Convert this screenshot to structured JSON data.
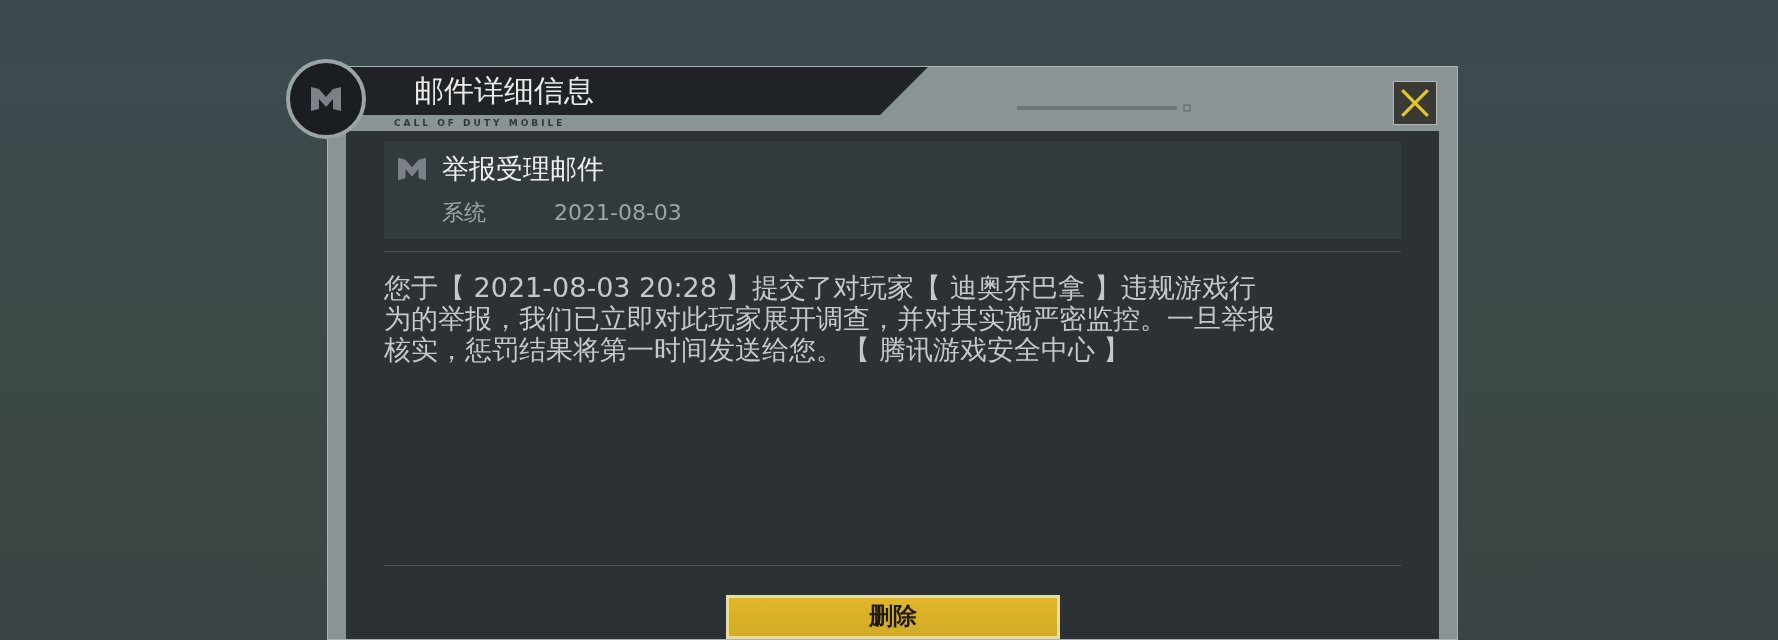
{
  "dialog": {
    "title": "邮件详细信息",
    "subtitle": "CALL OF DUTY MOBILE"
  },
  "mail": {
    "subject": "举报受理邮件",
    "sender": "系统",
    "date": "2021-08-03",
    "body": "您于【 2021-08-03 20:28 】提交了对玩家【 迪奥乔巴拿 】违规游戏行为的举报，我们已立即对此玩家展开调查，并对其实施严密监控。一旦举报核实，惩罚结果将第一时间发送给您。【 腾讯游戏安全中心 】"
  },
  "buttons": [
    {
      "label": "删除"
    }
  ]
}
